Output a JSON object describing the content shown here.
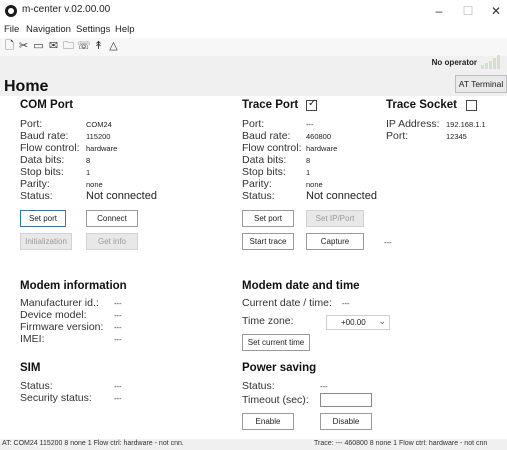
{
  "window": {
    "title": "m-center v.02.00.00",
    "minimize": "–",
    "maximize": "☐",
    "close": "✕"
  },
  "menu": [
    "File",
    "Navigation",
    "Settings",
    "Help"
  ],
  "toolbar_icons": [
    "new-file-icon",
    "disconnect-icon",
    "screen-icon",
    "message-icon",
    "folder-icon",
    "phonebook-icon",
    "antenna-icon",
    "warning-icon"
  ],
  "operator": "No operator",
  "page": {
    "title": "Home",
    "at_terminal_label": "AT Terminal"
  },
  "com_port": {
    "title": "COM Port",
    "labels": {
      "port": "Port:",
      "baud": "Baud rate:",
      "flow": "Flow control:",
      "data": "Data bits:",
      "stop": "Stop bits:",
      "parity": "Parity:",
      "status": "Status:"
    },
    "values": {
      "port": "COM24",
      "baud": "115200",
      "flow": "hardware",
      "data": "8",
      "stop": "1",
      "parity": "none",
      "status": "Not connected"
    },
    "buttons": {
      "set_port": "Set port",
      "connect": "Connect",
      "initialization": "Initialization",
      "get_info": "Get info"
    }
  },
  "trace_port": {
    "title": "Trace Port",
    "labels": {
      "port": "Port:",
      "baud": "Baud rate:",
      "flow": "Flow control:",
      "data": "Data bits:",
      "stop": "Stop bits:",
      "parity": "Parity:",
      "status": "Status:"
    },
    "values": {
      "port": "---",
      "baud": "460800",
      "flow": "hardware",
      "data": "8",
      "stop": "1",
      "parity": "none",
      "status": "Not connected"
    },
    "buttons": {
      "set_port": "Set port",
      "set_ip_port": "Set IP/Port",
      "start_trace": "Start trace",
      "capture": "Capture"
    },
    "capture_value": "---",
    "checked": true
  },
  "trace_socket": {
    "title": "Trace Socket",
    "labels": {
      "ip": "IP Address:",
      "port": "Port:"
    },
    "values": {
      "ip": "192.168.1.1",
      "port": "12345"
    },
    "checked": false
  },
  "modem_info": {
    "title": "Modem information",
    "labels": {
      "manufacturer": "Manufacturer id.:",
      "model": "Device model:",
      "firmware": "Firmware version:",
      "imei": "IMEI:"
    },
    "values": {
      "manufacturer": "---",
      "model": "---",
      "firmware": "---",
      "imei": "---"
    }
  },
  "modem_datetime": {
    "title": "Modem date and time",
    "labels": {
      "current": "Current date / time:",
      "timezone": "Time zone:"
    },
    "values": {
      "current": "---",
      "timezone": "+00.00"
    },
    "buttons": {
      "set_current_time": "Set current time"
    }
  },
  "sim": {
    "title": "SIM",
    "labels": {
      "status": "Status:",
      "security": "Security status:"
    },
    "values": {
      "status": "---",
      "security": "---"
    }
  },
  "power_saving": {
    "title": "Power saving",
    "labels": {
      "status": "Status:",
      "timeout": "Timeout (sec):"
    },
    "values": {
      "status": "---",
      "timeout": ""
    },
    "buttons": {
      "enable": "Enable",
      "disable": "Disable"
    }
  },
  "statusbar": {
    "left": "AT: COM24 115200 8 none 1 Flow ctrl: hardware - not cnn.",
    "right": "Trace: --- 460800 8 none 1 Flow ctrl: hardware - not cnn"
  },
  "colors": {
    "accent": "#1f7ad4",
    "signal": "#cfe3c8",
    "content_bg": "#ffffff",
    "chrome_bg": "#f0f0f0"
  }
}
